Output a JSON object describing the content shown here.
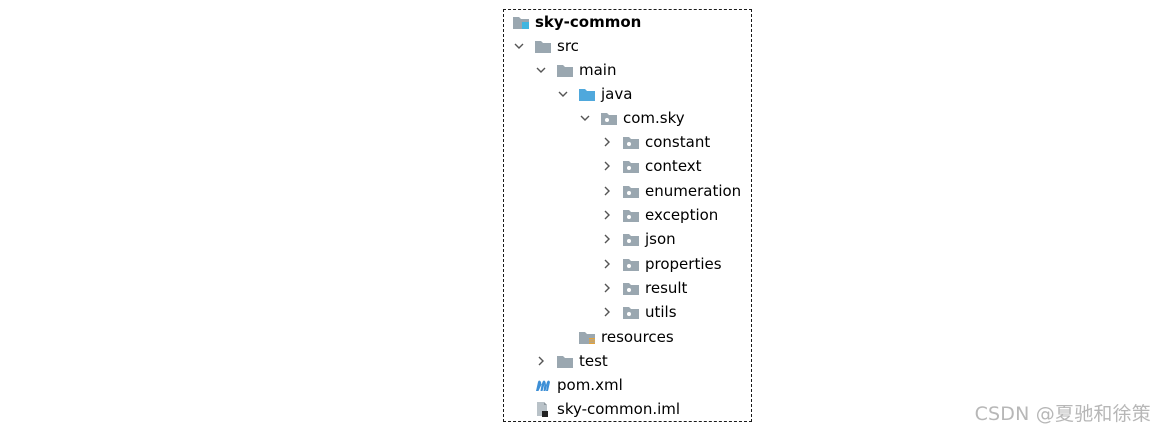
{
  "tree": {
    "root": {
      "label": "sky-common",
      "icon": "module-folder-icon"
    },
    "src": {
      "label": "src",
      "icon": "folder-icon"
    },
    "main": {
      "label": "main",
      "icon": "folder-icon"
    },
    "java": {
      "label": "java",
      "icon": "source-root-folder-icon"
    },
    "com_sky": {
      "label": "com.sky",
      "icon": "package-icon"
    },
    "packages": [
      {
        "label": "constant",
        "icon": "package-icon"
      },
      {
        "label": "context",
        "icon": "package-icon"
      },
      {
        "label": "enumeration",
        "icon": "package-icon"
      },
      {
        "label": "exception",
        "icon": "package-icon"
      },
      {
        "label": "json",
        "icon": "package-icon"
      },
      {
        "label": "properties",
        "icon": "package-icon"
      },
      {
        "label": "result",
        "icon": "package-icon"
      },
      {
        "label": "utils",
        "icon": "package-icon"
      }
    ],
    "resources": {
      "label": "resources",
      "icon": "resources-folder-icon"
    },
    "test": {
      "label": "test",
      "icon": "folder-icon"
    },
    "pom": {
      "label": "pom.xml",
      "icon": "maven-icon"
    },
    "iml": {
      "label": "sky-common.iml",
      "icon": "iml-file-icon"
    }
  },
  "colors": {
    "folder": "#9aa7b0",
    "source_root": "#4fa8dc",
    "module_marker": "#40b6e0",
    "maven": "#3d8fd6",
    "resources_marker": "#e4a33b",
    "chevron": "#555555",
    "watermark": "#b7b7b7"
  },
  "watermark": "CSDN @夏驰和徐策"
}
